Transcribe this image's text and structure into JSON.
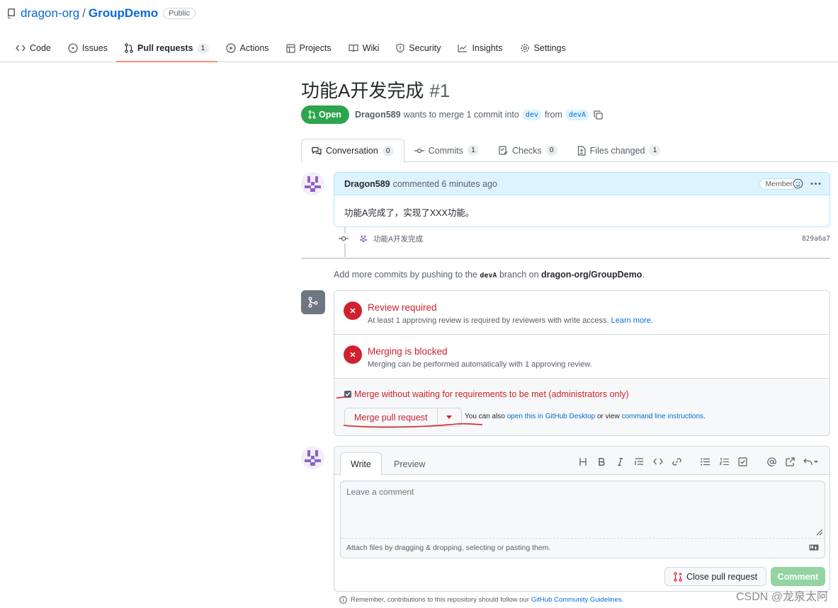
{
  "repo": {
    "owner": "dragon-org",
    "separator": "/",
    "name": "GroupDemo",
    "visibility": "Public"
  },
  "nav": [
    {
      "label": "Code",
      "icon": "code-icon"
    },
    {
      "label": "Issues",
      "icon": "issue-icon"
    },
    {
      "label": "Pull requests",
      "icon": "pull-request-icon",
      "count": "1",
      "selected": true
    },
    {
      "label": "Actions",
      "icon": "play-icon"
    },
    {
      "label": "Projects",
      "icon": "table-icon"
    },
    {
      "label": "Wiki",
      "icon": "book-icon"
    },
    {
      "label": "Security",
      "icon": "shield-icon"
    },
    {
      "label": "Insights",
      "icon": "graph-icon"
    },
    {
      "label": "Settings",
      "icon": "gear-icon"
    }
  ],
  "pr": {
    "title": "功能A开发完成",
    "number": "#1",
    "state": "Open",
    "author": "Dragon589",
    "meta_text": "wants to merge 1 commit into",
    "base_branch": "dev",
    "from_text": "from",
    "head_branch": "devA"
  },
  "tabs": [
    {
      "label": "Conversation",
      "count": "0",
      "icon": "comment-discussion-icon",
      "selected": true
    },
    {
      "label": "Commits",
      "count": "1",
      "icon": "commit-icon"
    },
    {
      "label": "Checks",
      "count": "0",
      "icon": "checklist-icon"
    },
    {
      "label": "Files changed",
      "count": "1",
      "icon": "file-diff-icon"
    }
  ],
  "comment": {
    "author": "Dragon589",
    "action": "commented 6 minutes ago",
    "badge": "Member",
    "body": "功能A完成了，实现了XXX功能。"
  },
  "commit": {
    "message": "功能A开发完成",
    "sha": "829a6a7"
  },
  "add_more": {
    "prefix": "Add more commits by pushing to the",
    "branch": "devA",
    "middle": "branch on",
    "repo": "dragon-org/GroupDemo",
    "suffix": "."
  },
  "merge": {
    "review_title": "Review required",
    "review_desc": "At least 1 approving review is required by reviewers with write access.",
    "learn_more": "Learn more.",
    "blocked_title": "Merging is blocked",
    "blocked_desc": "Merging can be performed automatically with 1 approving review.",
    "admin_label": "Merge without waiting for requirements to be met (administrators only)",
    "admin_checked": true,
    "button": "Merge pull request",
    "alt_prefix": "You can also",
    "alt_link1": "open this in GitHub Desktop",
    "alt_middle": "or view",
    "alt_link2": "command line instructions",
    "alt_suffix": "."
  },
  "editor": {
    "tab_write": "Write",
    "tab_preview": "Preview",
    "placeholder": "Leave a comment",
    "attach_text": "Attach files by dragging & dropping, selecting or pasting them.",
    "close_button": "Close pull request",
    "comment_button": "Comment"
  },
  "remember": {
    "text": "Remember, contributions to this repository should follow our",
    "link": "GitHub Community Guidelines",
    "suffix": "."
  },
  "watermark": "CSDN @龙泉太阿",
  "colors": {
    "accent_blue": "#0969da",
    "open_green": "#2da44e",
    "danger_red": "#cf222e",
    "selected_underline": "#fd8c73"
  }
}
